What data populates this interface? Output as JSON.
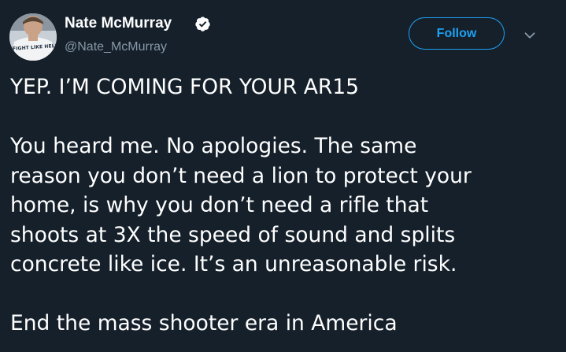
{
  "tweet": {
    "author": {
      "name": "Nate McMurray",
      "handle": "@Nate_McMurray",
      "verified": true,
      "avatar_caption": "FIGHT LIKE HELL"
    },
    "follow_label": "Follow",
    "lines": [
      "YEP. I’M COMING FOR YOUR AR15",
      "",
      "You heard me. No apologies. The same",
      "reason you don’t need a lion to protect your",
      "home, is why you don’t need a rifle that",
      "shoots at 3X the speed of sound and splits",
      "concrete like ice. It’s an unreasonable risk.",
      "",
      "End the mass shooter era in America"
    ]
  },
  "colors": {
    "background": "#15202b",
    "accent": "#1da1f2",
    "secondary_text": "#8899a6",
    "primary_text": "#ffffff"
  },
  "icons": {
    "verified": "verified-badge-icon",
    "more": "chevron-down-icon"
  }
}
